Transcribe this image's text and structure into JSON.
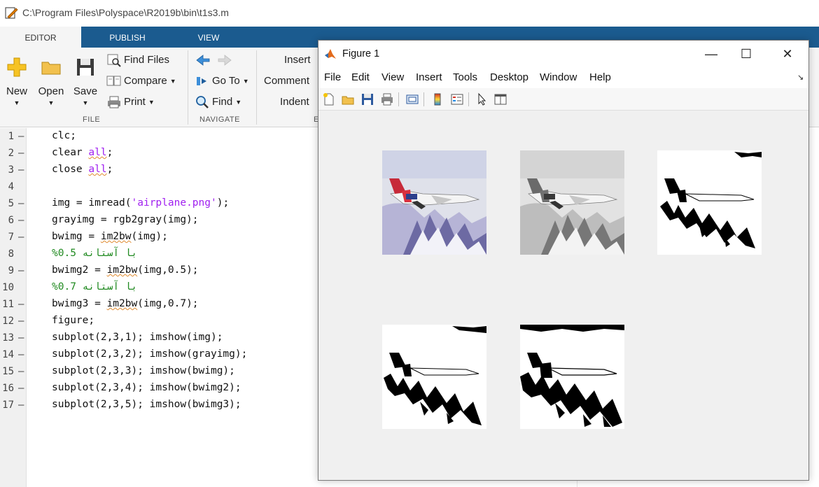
{
  "window": {
    "title": "C:\\Program Files\\Polyspace\\R2019b\\bin\\t1s3.m"
  },
  "ribbon": {
    "tabs": [
      {
        "label": "EDITOR",
        "active": true
      },
      {
        "label": "PUBLISH",
        "active": false
      },
      {
        "label": "VIEW",
        "active": false
      }
    ],
    "file_group": {
      "label": "FILE",
      "new": "New",
      "open": "Open",
      "save": "Save",
      "find_files": "Find Files",
      "compare": "Compare",
      "print": "Print"
    },
    "navigate_group": {
      "label": "NAVIGATE",
      "go_to": "Go To",
      "find": "Find"
    },
    "edit_group": {
      "label": "E",
      "insert": "Insert",
      "comment": "Comment",
      "indent": "Indent"
    }
  },
  "editor": {
    "lines": [
      {
        "no": "1",
        "code": "clc;"
      },
      {
        "no": "2",
        "code": "clear all;"
      },
      {
        "no": "3",
        "code": "close all;"
      },
      {
        "no": "4",
        "code": ""
      },
      {
        "no": "5",
        "code": "img = imread('airplane.png');"
      },
      {
        "no": "6",
        "code": "grayimg = rgb2gray(img);"
      },
      {
        "no": "7",
        "code": "bwimg = im2bw(img);"
      },
      {
        "no": "8",
        "code": "%با آستانه 0.5"
      },
      {
        "no": "9",
        "code": "bwimg2 = im2bw(img,0.5);"
      },
      {
        "no": "10",
        "code": "%با آستانه 0.7"
      },
      {
        "no": "11",
        "code": "bwimg3 = im2bw(img,0.7);"
      },
      {
        "no": "12",
        "code": "figure;"
      },
      {
        "no": "13",
        "code": "subplot(2,3,1); imshow(img);"
      },
      {
        "no": "14",
        "code": "subplot(2,3,2); imshow(grayimg);"
      },
      {
        "no": "15",
        "code": "subplot(2,3,3); imshow(bwimg);"
      },
      {
        "no": "16",
        "code": "subplot(2,3,4); imshow(bwimg2);"
      },
      {
        "no": "17",
        "code": "subplot(2,3,5); imshow(bwimg3);"
      }
    ],
    "colors": {
      "keyword": "#a020f0",
      "string": "#a020f0",
      "comment": "#228b22"
    }
  },
  "figure": {
    "title": "Figure 1",
    "menu": [
      "File",
      "Edit",
      "View",
      "Insert",
      "Tools",
      "Desktop",
      "Window",
      "Help"
    ],
    "toolbar_icons": [
      "new-figure-icon",
      "open-file-icon",
      "save-figure-icon",
      "print-figure-icon",
      "link-plot-icon",
      "insert-colorbar-icon",
      "insert-legend-icon",
      "edit-plot-icon",
      "property-inspector-icon"
    ],
    "subplots": [
      {
        "index": 1,
        "content": "airplane color image"
      },
      {
        "index": 2,
        "content": "airplane grayscale image"
      },
      {
        "index": 3,
        "content": "airplane binary image"
      },
      {
        "index": 4,
        "content": "airplane binary image threshold 0.5"
      },
      {
        "index": 5,
        "content": "airplane binary image threshold 0.7"
      }
    ]
  },
  "colors": {
    "ribbon_tab_bar": "#1b5b8f",
    "ribbon_bg": "#f5f5f5",
    "figure_bg": "#f0f0f0"
  }
}
